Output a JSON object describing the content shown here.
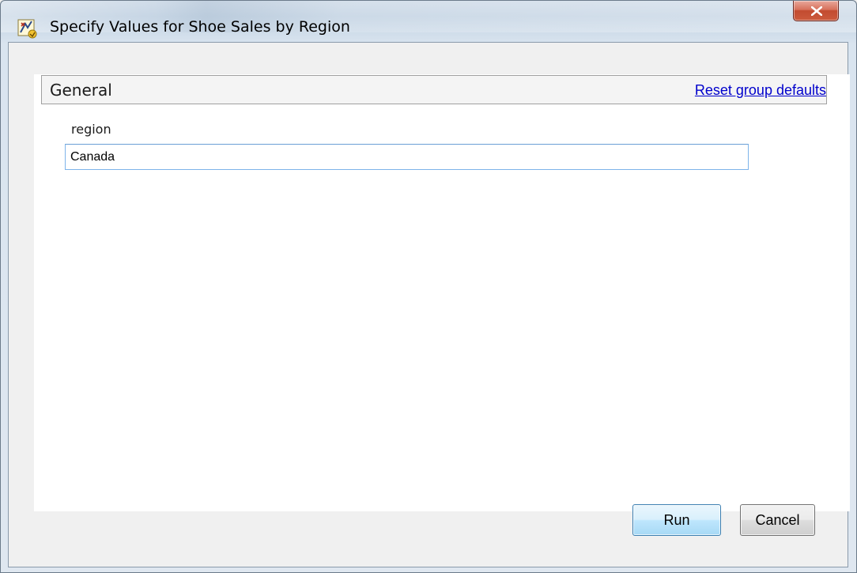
{
  "window": {
    "title": "Specify Values for Shoe Sales by Region",
    "icon": "report-wizard-icon",
    "close_icon": "close-icon"
  },
  "group": {
    "title": "General",
    "reset_link": "Reset group defaults"
  },
  "parameter": {
    "label": "region",
    "value": "Canada"
  },
  "buttons": {
    "run": "Run",
    "cancel": "Cancel"
  },
  "colors": {
    "link": "#0000cc",
    "close_button": "#c24b30",
    "input_border": "#7eb4ea",
    "default_button_border": "#3c7fb1"
  }
}
